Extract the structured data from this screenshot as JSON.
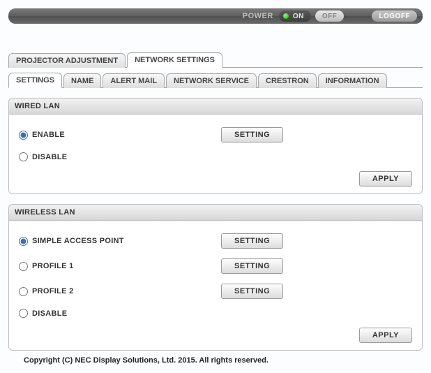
{
  "topbar": {
    "power_label": "POWER",
    "on_label": "ON",
    "off_label": "OFF",
    "logoff_label": "LOGOFF"
  },
  "tabs_main": {
    "items": [
      {
        "label": "PROJECTOR ADJUSTMENT"
      },
      {
        "label": "NETWORK SETTINGS"
      }
    ],
    "active_index": 1
  },
  "tabs_sub": {
    "items": [
      {
        "label": "SETTINGS"
      },
      {
        "label": "NAME"
      },
      {
        "label": "ALERT MAIL"
      },
      {
        "label": "NETWORK SERVICE"
      },
      {
        "label": "CRESTRON"
      },
      {
        "label": "INFORMATION"
      }
    ],
    "active_index": 0
  },
  "wired": {
    "title": "WIRED LAN",
    "options": {
      "enable": "ENABLE",
      "disable": "DISABLE",
      "selected": "enable"
    },
    "setting_button": "SETTING",
    "apply_button": "APPLY"
  },
  "wireless": {
    "title": "WIRELESS LAN",
    "options": {
      "sap": "SIMPLE ACCESS POINT",
      "p1": "PROFILE 1",
      "p2": "PROFILE 2",
      "disable": "DISABLE",
      "selected": "sap"
    },
    "setting_button": "SETTING",
    "apply_button": "APPLY"
  },
  "footer": "Copyright (C) NEC Display Solutions, Ltd. 2015. All rights reserved."
}
